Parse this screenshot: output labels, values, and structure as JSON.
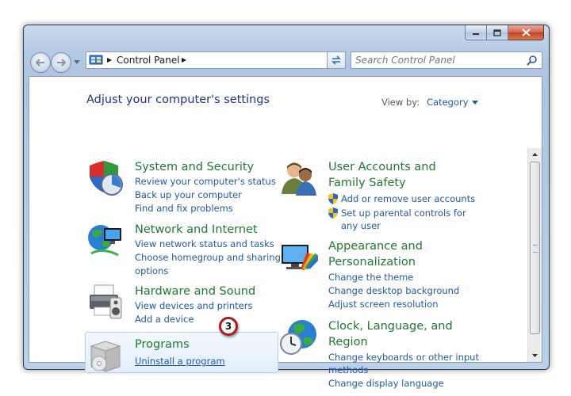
{
  "address": {
    "path": "Control Panel"
  },
  "search": {
    "placeholder": "Search Control Panel"
  },
  "heading": "Adjust your computer's settings",
  "view_by": {
    "label": "View by:",
    "value": "Category"
  },
  "categories": {
    "system": {
      "title": "System and Security",
      "links": [
        "Review your computer's status",
        "Back up your computer",
        "Find and fix problems"
      ]
    },
    "network": {
      "title": "Network and Internet",
      "links": [
        "View network status and tasks",
        "Choose homegroup and sharing",
        "options"
      ]
    },
    "hardware": {
      "title": "Hardware and Sound",
      "links": [
        "View devices and printers",
        "Add a device"
      ]
    },
    "programs": {
      "title": "Programs",
      "links": [
        "Uninstall a program"
      ]
    },
    "users": {
      "title": [
        "User Accounts and",
        "Family Safety"
      ],
      "links": [
        "Add or remove user accounts",
        "Set up parental controls for",
        "any user"
      ]
    },
    "appearance": {
      "title": [
        "Appearance and",
        "Personalization"
      ],
      "links": [
        "Change the theme",
        "Change desktop background",
        "Adjust screen resolution"
      ]
    },
    "clock": {
      "title": [
        "Clock, Language, and",
        "Region"
      ],
      "links": [
        "Change keyboards or other input",
        "methods",
        "Change display language"
      ]
    }
  },
  "callout": "3",
  "colors": {
    "title_green": "#1e7a2f",
    "link_blue": "#1e5aa8",
    "heading_blue": "#1e3287",
    "callout_red": "#a81e1e"
  }
}
